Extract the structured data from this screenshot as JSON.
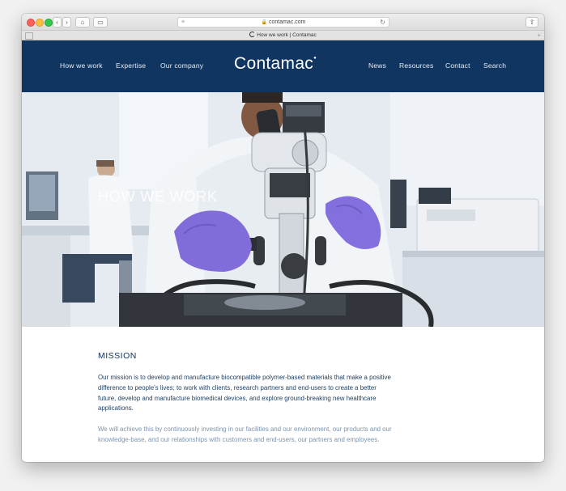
{
  "browser": {
    "url": "contamac.com",
    "tab_title": "How we work | Contamac"
  },
  "header": {
    "nav_left": [
      "How we work",
      "Expertise",
      "Our company"
    ],
    "logo": "Contamac",
    "nav_right": [
      "News",
      "Resources",
      "Contact",
      "Search"
    ]
  },
  "hero": {
    "title": "HOW WE WORK"
  },
  "content": {
    "mission_title": "MISSION",
    "paragraph1": "Our mission is to develop and manufacture biocompatible polymer-based materials that make a positive difference to people's lives; to work with clients, research partners and end-users to create a better future, develop and manufacture biomedical devices, and explore ground-breaking new healthcare applications.",
    "paragraph2": "We will achieve this by continuously investing in our facilities and our environment, our products and our knowledge-base, and our relationships with customers and end-users, our partners and employees."
  },
  "colors": {
    "header_bg": "#0f3560",
    "glove": "#7b63d8",
    "muted_text": "#7d94ab"
  }
}
